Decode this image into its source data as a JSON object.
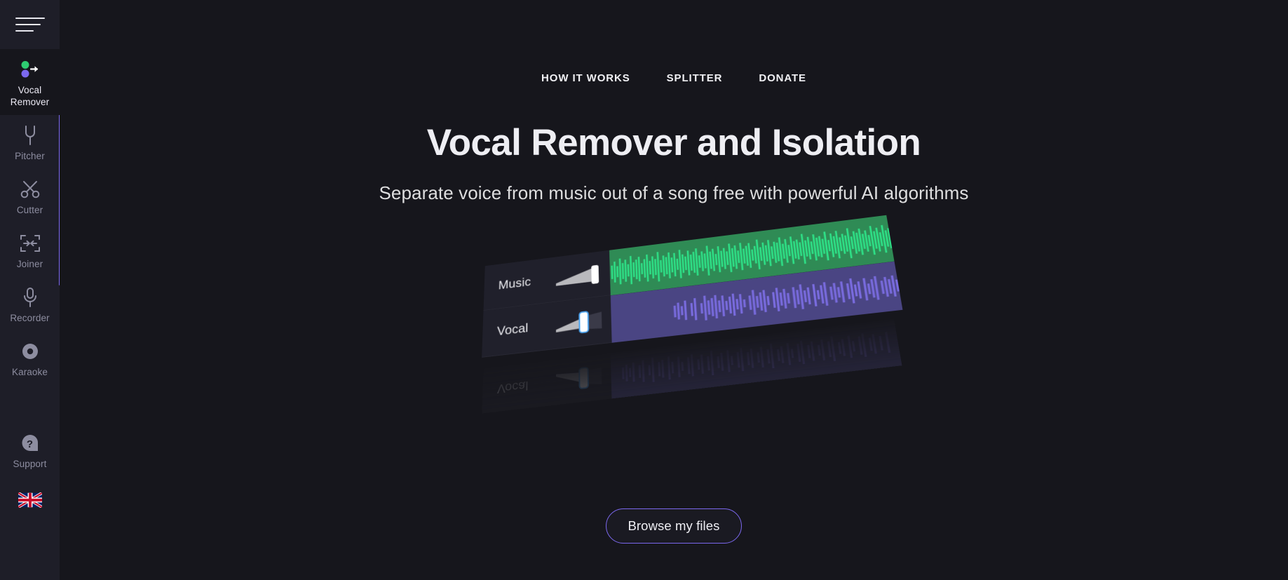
{
  "sidebar": {
    "menu_icon": "hamburger-icon",
    "items": [
      {
        "label": "Vocal Remover",
        "icon": "vocal-remover-icon",
        "active": true
      },
      {
        "label": "Pitcher",
        "icon": "tuning-fork-icon",
        "active": false
      },
      {
        "label": "Cutter",
        "icon": "scissors-icon",
        "active": false
      },
      {
        "label": "Joiner",
        "icon": "join-arrows-icon",
        "active": false
      },
      {
        "label": "Recorder",
        "icon": "microphone-icon",
        "active": false
      },
      {
        "label": "Karaoke",
        "icon": "record-dot-icon",
        "active": false
      },
      {
        "label": "Support",
        "icon": "question-mark-icon",
        "active": false
      }
    ],
    "language_flag": "uk-flag-icon",
    "active_indicator_color": "#7b68ee"
  },
  "topnav": {
    "links": [
      {
        "label": "HOW IT WORKS"
      },
      {
        "label": "SPLITTER"
      },
      {
        "label": "DONATE"
      }
    ]
  },
  "hero": {
    "title": "Vocal Remover and Isolation",
    "subtitle": "Separate voice from music out of a song free with powerful AI algorithms"
  },
  "illustration": {
    "tracks": [
      {
        "name": "Music",
        "color": "#2f8b55",
        "wave_color": "#2ee68a",
        "slider_focused": false
      },
      {
        "name": "Vocal",
        "color": "#4a4583",
        "wave_color": "#7a6ce0",
        "slider_focused": true
      }
    ],
    "reflection_label": "Vocal"
  },
  "cta": {
    "browse_label": "Browse my files",
    "accent_color": "#7b68ee"
  }
}
